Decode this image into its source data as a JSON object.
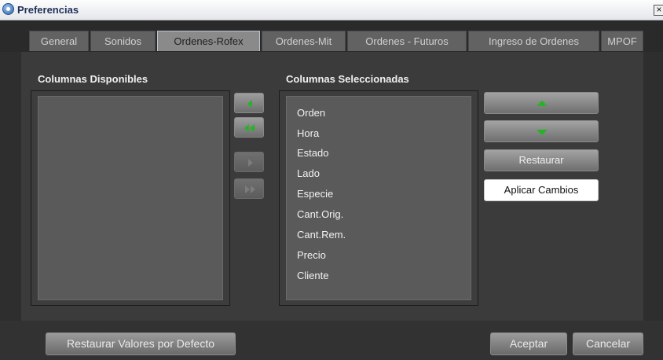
{
  "window": {
    "title": "Preferencias",
    "close_label": "×"
  },
  "tabs": [
    {
      "label": "General",
      "active": false
    },
    {
      "label": "Sonidos",
      "active": false
    },
    {
      "label": "Ordenes-Rofex",
      "active": true
    },
    {
      "label": "Ordenes-Mit",
      "active": false
    },
    {
      "label": "Ordenes - Futuros",
      "active": false
    },
    {
      "label": "Ingreso de Ordenes",
      "active": false
    },
    {
      "label": "MPOF",
      "active": false
    }
  ],
  "available": {
    "label": "Columnas Disponibles",
    "items": []
  },
  "selected": {
    "label": "Columnas Seleccionadas",
    "items": [
      "Orden",
      "Hora",
      "Estado",
      "Lado",
      "Especie",
      "Cant.Orig.",
      "Cant.Rem.",
      "Precio",
      "Cliente"
    ]
  },
  "transfer_buttons": [
    {
      "icon": "arrow-left-icon",
      "enabled": true
    },
    {
      "icon": "double-arrow-left-icon",
      "enabled": true
    },
    {
      "icon": "arrow-right-icon",
      "enabled": false
    },
    {
      "icon": "double-arrow-right-icon",
      "enabled": false
    }
  ],
  "order_buttons": {
    "up_icon": "arrow-up-icon",
    "down_icon": "arrow-down-icon",
    "restore_label": "Restaurar",
    "apply_label": "Aplicar Cambios"
  },
  "footer": {
    "restore_defaults_label": "Restaurar Valores por Defecto",
    "accept_label": "Aceptar",
    "cancel_label": "Cancelar"
  },
  "colors": {
    "accent_arrow": "#27b227",
    "background": "#2e2e2e"
  }
}
